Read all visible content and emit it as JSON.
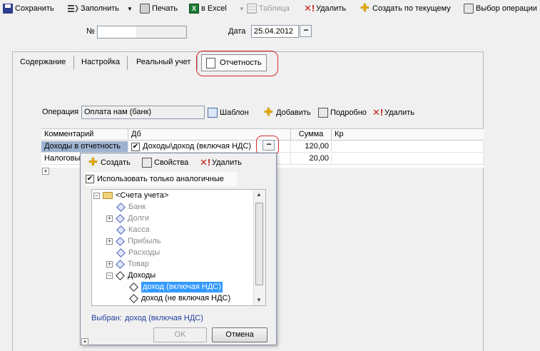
{
  "toolbar": {
    "save": "Сохранить",
    "fill": "Заполнить",
    "print": "Печать",
    "excel": "в Excel",
    "table": "Таблица",
    "delete": "Удалить",
    "create_current": "Создать по текущему",
    "choose_operation": "Выбор операции"
  },
  "header": {
    "number_label": "№",
    "number_value": "",
    "date_label": "Дата",
    "date_value": "25.04.2012"
  },
  "tabs": [
    "Содержание",
    "Настройка",
    "Реальный учет",
    "Отчетность"
  ],
  "operation": {
    "label": "Операция",
    "value": "Оплата нам (банк)",
    "template": "Шаблон",
    "add": "Добавить",
    "details": "Подробно",
    "delete": "Удалить"
  },
  "grid": {
    "columns": [
      "Комментарий",
      "Дб",
      "Сумма",
      "Кр"
    ],
    "rows": [
      {
        "comment": "Доходы в отчетность",
        "db": "Доходы\\доход (включая НДС)",
        "sum": "120,00"
      },
      {
        "comment": "Налоговы",
        "db": "",
        "sum": "20,00"
      }
    ]
  },
  "popup": {
    "create": "Создать",
    "properties": "Свойства",
    "delete": "Удалить",
    "only_similar": "Использовать только аналогичные",
    "tree": {
      "root": "<Счета учета>",
      "items": [
        "Банк",
        "Долги",
        "Касса",
        "Прибыль",
        "Расходы",
        "Товар",
        "Доходы"
      ],
      "children": [
        "доход (включая НДС)",
        "доход (не включая НДС)"
      ]
    },
    "selected_label": "Выбран:",
    "selected_value": "доход (включая НДС)",
    "ok": "OK",
    "cancel": "Отмена"
  },
  "colors": {
    "accent_red": "#d42b2b",
    "selection": "#3399ff",
    "selected_text": "#1f3fa0"
  }
}
